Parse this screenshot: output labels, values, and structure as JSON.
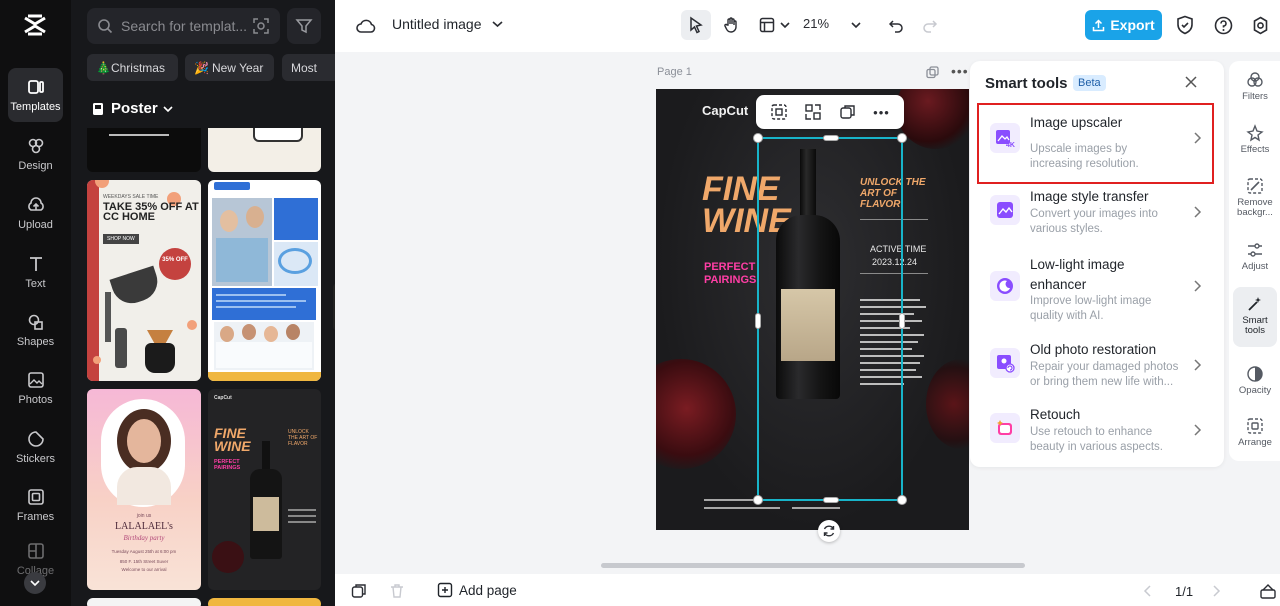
{
  "rail": {
    "items": [
      {
        "label": "Templates",
        "icon": "templates-icon"
      },
      {
        "label": "Design",
        "icon": "design-icon"
      },
      {
        "label": "Upload",
        "icon": "upload-icon"
      },
      {
        "label": "Text",
        "icon": "text-icon"
      },
      {
        "label": "Shapes",
        "icon": "shapes-icon"
      },
      {
        "label": "Photos",
        "icon": "photos-icon"
      },
      {
        "label": "Stickers",
        "icon": "stickers-icon"
      },
      {
        "label": "Frames",
        "icon": "frames-icon"
      },
      {
        "label": "Collage",
        "icon": "collage-icon"
      }
    ]
  },
  "templates": {
    "search_placeholder": "Search for templat...",
    "chips": [
      "Christmas",
      "New Year",
      "Most"
    ],
    "chip_emojis": [
      "🎄",
      "🎉",
      ""
    ],
    "category": "Poster",
    "cards": {
      "coffee": {
        "kicker": "WEEKDAYS SALE TIME",
        "headline": "TAKE 35% OFF AT CC HOME",
        "cta": "SHOP NOW",
        "badge": "35% OFF"
      },
      "birthday": {
        "join": "join us",
        "name": "LALALAEL's",
        "event": "Birthday party",
        "date": "Tuesday August 25th at 6:00 pm",
        "address": "850 F. 15th Street Suver",
        "welcome": "Welcome to our arrival"
      },
      "wine": {
        "brand": "CapCut",
        "headline": "FINE WINE",
        "side": "UNLOCK THE ART OF FLAVOR",
        "sub": "PERFECT PAIRINGS"
      }
    }
  },
  "topbar": {
    "doc_title": "Untitled image",
    "zoom": "21%",
    "export_label": "Export"
  },
  "canvas": {
    "page_label": "Page 1",
    "poster": {
      "brand": "CapCut",
      "headline_line1": "FINE",
      "headline_line2": "WINE",
      "unlock_text": "UNLOCK THE ART OF FLAVOR",
      "active_time_label": "ACTIVE TIME",
      "active_time_value": "2023.12.24",
      "pairings_line1": "PERFECT",
      "pairings_line2": "PAIRINGS"
    }
  },
  "smart_tools": {
    "title": "Smart tools",
    "badge": "Beta",
    "items": [
      {
        "name": "Image upscaler",
        "desc": "Upscale images by increasing resolution.",
        "icon": "upscaler-icon"
      },
      {
        "name": "Image style transfer",
        "desc": "Convert your images into various styles.",
        "icon": "style-transfer-icon"
      },
      {
        "name": "Low-light image enhancer",
        "desc": "Improve low-light image quality with AI.",
        "icon": "low-light-icon"
      },
      {
        "name": "Old photo restoration",
        "desc": "Repair your damaged photos or bring them new life with...",
        "icon": "photo-restoration-icon"
      },
      {
        "name": "Retouch",
        "desc": "Use retouch to enhance beauty in various aspects.",
        "icon": "retouch-icon"
      }
    ]
  },
  "right_rail": {
    "items": [
      {
        "label": "Filters"
      },
      {
        "label": "Effects"
      },
      {
        "label": "Remove backgr..."
      },
      {
        "label": "Adjust"
      },
      {
        "label": "Smart tools"
      },
      {
        "label": "Opacity"
      },
      {
        "label": "Arrange"
      }
    ]
  },
  "bottombar": {
    "add_page_label": "Add page",
    "page_count": "1/1"
  },
  "colors": {
    "accent": "#1aa3e8",
    "highlight": "#e02020",
    "wine_orange": "#f0a86a",
    "wine_pink": "#ff3ea5",
    "selection": "#18b4c9"
  }
}
